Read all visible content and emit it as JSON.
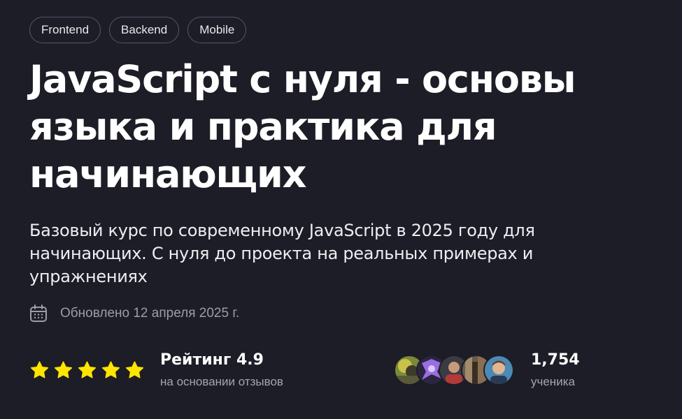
{
  "tags": [
    "Frontend",
    "Backend",
    "Mobile"
  ],
  "course": {
    "title": "JavaScript с нуля - основы языка и практика для начинающих",
    "subtitle": "Базовый курс по современному JavaScript в 2025 году для начинающих. С нуля до проекта на реальных примерах и упражнениях",
    "updated": "Обновлено 12 апреля 2025 г."
  },
  "rating": {
    "label": "Рейтинг 4.9",
    "value": 4.9,
    "stars_filled": 5,
    "stars_total": 5,
    "caption": "на основании отзывов",
    "star_color": "#ffe500"
  },
  "students": {
    "count": "1,754",
    "caption": "ученика",
    "avatars": [
      "avatar-1",
      "avatar-2",
      "avatar-3",
      "avatar-4",
      "avatar-5"
    ]
  },
  "icons": {
    "updated": "calendar-icon",
    "rating": "star-icon"
  },
  "colors": {
    "background": "#1d1d27",
    "text": "#ffffff",
    "muted": "#9d9daa",
    "tag_border": "#55556a"
  }
}
